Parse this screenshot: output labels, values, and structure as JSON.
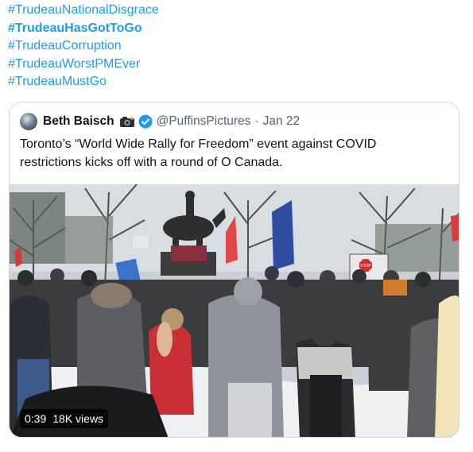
{
  "hashtags": [
    {
      "text": "#TrudeauNationalDisgrace",
      "bold": false
    },
    {
      "text": "#TrudeauHasGotToGo",
      "bold": true
    },
    {
      "text": "#TrudeauCorruption",
      "bold": false
    },
    {
      "text": "#TrudeauWorstPMEver",
      "bold": false
    },
    {
      "text": "#TrudeauMustGo",
      "bold": false
    }
  ],
  "quote": {
    "author_name": "Beth Baisch",
    "author_emoji": "camera-with-flash",
    "verified_icon": "verified-badge-icon",
    "handle": "@PuffinsPictures",
    "separator": "·",
    "date": "Jan 22",
    "text_line1": "Toronto’s “World Wide Rally for Freedom” event against COVID",
    "text_line2": "restrictions kicks off with a round of O Canada.",
    "video": {
      "duration": "0:39",
      "separator": "",
      "views": "18K views",
      "sign_text": "STOP"
    }
  },
  "colors": {
    "link": "#1d9bf0",
    "text": "#0f1419",
    "secondary": "#536471",
    "border": "#cfd9de",
    "verified": "#1d9bf0"
  }
}
